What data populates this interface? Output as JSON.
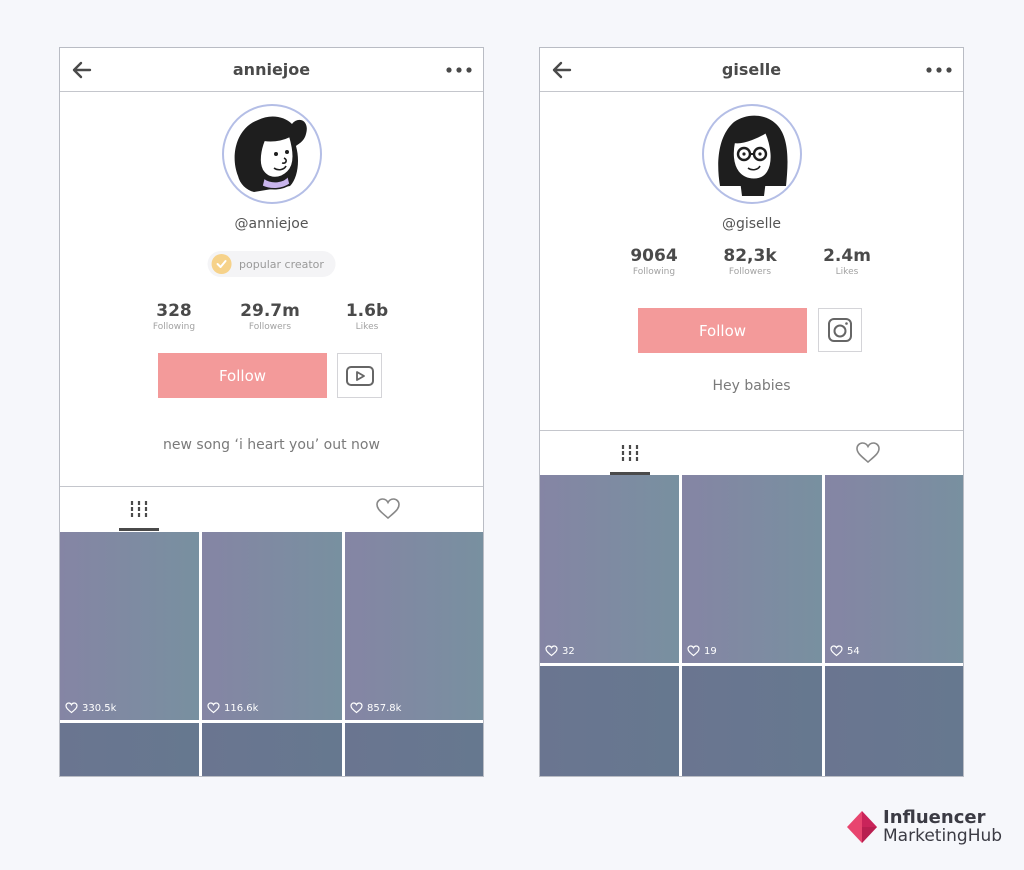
{
  "profiles": [
    {
      "header_title": "anniejoe",
      "handle": "@anniejoe",
      "badge": "popular creator",
      "stats": [
        {
          "value": "328",
          "label": "Following"
        },
        {
          "value": "29.7m",
          "label": "Followers"
        },
        {
          "value": "1.6b",
          "label": "Likes"
        }
      ],
      "follow_label": "Follow",
      "social_icon": "youtube-icon",
      "bio": "new song ‘i heart you’ out now",
      "tabs": [
        "videos-tab",
        "liked-tab"
      ],
      "tiles": [
        {
          "likes": "330.5k"
        },
        {
          "likes": "116.6k"
        },
        {
          "likes": "857.8k"
        },
        {
          "likes": null
        },
        {
          "likes": null
        },
        {
          "likes": null
        }
      ]
    },
    {
      "header_title": "giselle",
      "handle": "@giselle",
      "stats": [
        {
          "value": "9064",
          "label": "Following"
        },
        {
          "value": "82,3k",
          "label": "Followers"
        },
        {
          "value": "2.4m",
          "label": "Likes"
        }
      ],
      "follow_label": "Follow",
      "social_icon": "instagram-icon",
      "bio": "Hey babies",
      "tabs": [
        "videos-tab",
        "liked-tab"
      ],
      "tiles": [
        {
          "likes": "32"
        },
        {
          "likes": "19"
        },
        {
          "likes": "54"
        },
        {
          "likes": null
        },
        {
          "likes": null
        },
        {
          "likes": null
        }
      ]
    }
  ],
  "logo": {
    "line1": "Influencer",
    "line2": "MarketingHub"
  },
  "colors": {
    "follow": "#f39a9a",
    "avatar_ring": "#b4bee6",
    "badge_check": "#f6d28a",
    "logo_mark": "#e8456f",
    "background": "#f6f7fb"
  }
}
